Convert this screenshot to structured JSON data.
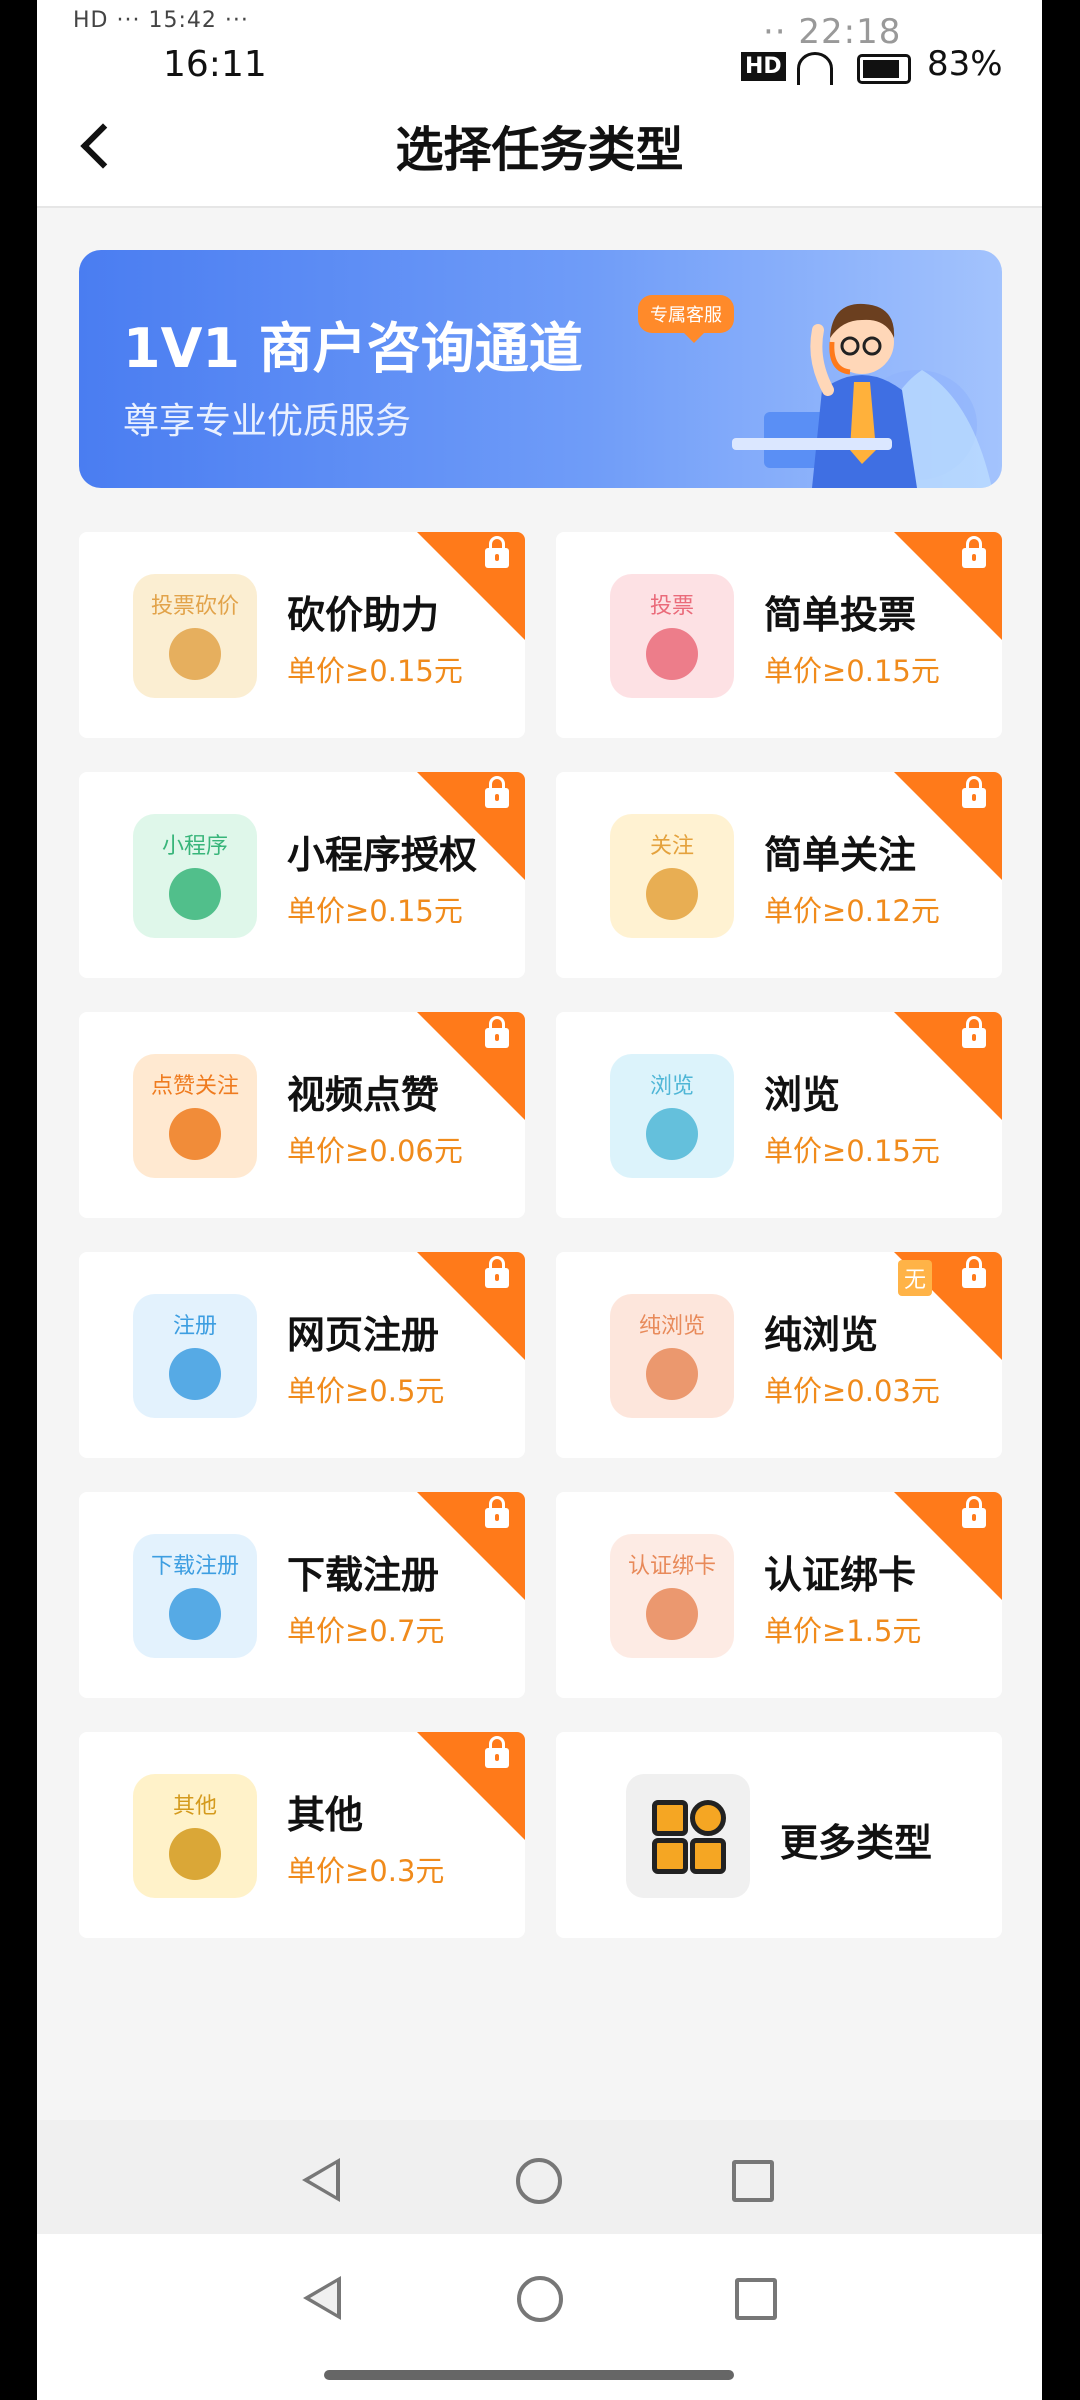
{
  "status": {
    "glitch_left": "HD ··· 15:42 ···",
    "glitch_right": "·· 22:18",
    "time": "16:11",
    "battery": "83%"
  },
  "header": {
    "title": "选择任务类型"
  },
  "banner": {
    "title": "1V1 商户咨询通道",
    "subtitle": "尊享专业优质服务",
    "bubble": "专属客服"
  },
  "tasks": [
    {
      "icon_label": "投票砍价",
      "name": "砍价助力",
      "price": "单价≥0.15元",
      "icon": "vote-bargain-icon",
      "icon_color": "#fbeed2",
      "label_color": "#e2a34a",
      "locked": true
    },
    {
      "icon_label": "投票",
      "name": "简单投票",
      "price": "单价≥0.15元",
      "icon": "vote-icon",
      "icon_color": "#fde1e4",
      "label_color": "#ea6b7a",
      "locked": true
    },
    {
      "icon_label": "小程序",
      "name": "小程序授权",
      "price": "单价≥0.15元",
      "icon": "mini-program-icon",
      "icon_color": "#dff7ea",
      "label_color": "#38b57a",
      "locked": true
    },
    {
      "icon_label": "关注",
      "name": "简单关注",
      "price": "单价≥0.12元",
      "icon": "follow-icon",
      "icon_color": "#fff2d2",
      "label_color": "#e4a23d",
      "locked": true
    },
    {
      "icon_label": "点赞关注",
      "name": "视频点赞",
      "price": "单价≥0.06元",
      "icon": "thumbs-up-icon",
      "icon_color": "#ffe9d1",
      "label_color": "#ef7b1f",
      "locked": true
    },
    {
      "icon_label": "浏览",
      "name": "浏览",
      "price": "单价≥0.15元",
      "icon": "eye-icon",
      "icon_color": "#dcf3fb",
      "label_color": "#4fb6d6",
      "locked": true
    },
    {
      "icon_label": "注册",
      "name": "网页注册",
      "price": "单价≥0.5元",
      "icon": "register-icon",
      "icon_color": "#e3f2fd",
      "label_color": "#3d9ee1",
      "locked": true
    },
    {
      "icon_label": "纯浏览",
      "name": "纯浏览",
      "price": "单价≥0.03元",
      "icon": "pure-browse-icon",
      "icon_color": "#fde6dc",
      "label_color": "#e88a5a",
      "locked": true,
      "tag": "无"
    },
    {
      "icon_label": "下载注册",
      "name": "下载注册",
      "price": "单价≥0.7元",
      "icon": "download-register-icon",
      "icon_color": "#e3f2fd",
      "label_color": "#3d9ee1",
      "locked": true
    },
    {
      "icon_label": "认证绑卡",
      "name": "认证绑卡",
      "price": "单价≥1.5元",
      "icon": "bind-card-icon",
      "icon_color": "#fdebe4",
      "label_color": "#e88a5a",
      "locked": true
    },
    {
      "icon_label": "其他",
      "name": "其他",
      "price": "单价≥0.3元",
      "icon": "other-icon",
      "icon_color": "#fff2c9",
      "label_color": "#d49a1d",
      "locked": true
    }
  ],
  "more": {
    "label": "更多类型",
    "icon": "more-grid-icon"
  },
  "navbar": {
    "back": "nav-back-icon",
    "home": "nav-home-icon",
    "recent": "nav-recent-icon"
  }
}
